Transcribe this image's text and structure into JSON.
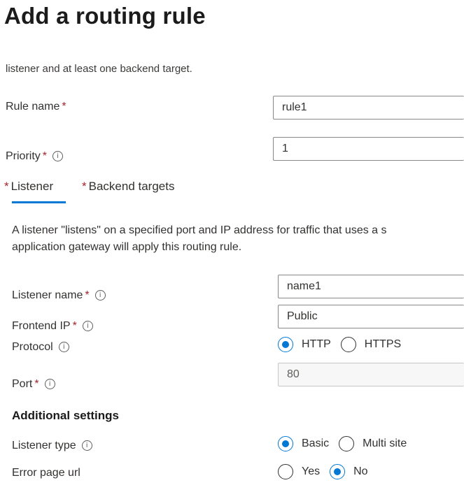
{
  "page": {
    "title": "Add a routing rule",
    "subtitle": "listener and at least one backend target."
  },
  "rule": {
    "name_label": "Rule name",
    "name_value": "rule1",
    "priority_label": "Priority",
    "priority_value": "1",
    "required_mark": "*",
    "info_glyph": "i"
  },
  "tabs": [
    {
      "label": "Listener",
      "selected": true
    },
    {
      "label": "Backend targets",
      "selected": false
    }
  ],
  "listener": {
    "description_line1": "A listener \"listens\" on a specified port and IP address for traffic that uses a s",
    "description_line2": "application gateway will apply this routing rule.",
    "name_label": "Listener name",
    "name_value": "name1",
    "frontend_ip_label": "Frontend IP",
    "frontend_ip_value": "Public",
    "protocol_label": "Protocol",
    "protocol_options": [
      "HTTP",
      "HTTPS"
    ],
    "protocol_selected": "HTTP",
    "port_label": "Port",
    "port_value": "80"
  },
  "additional_settings": {
    "heading": "Additional settings",
    "listener_type_label": "Listener type",
    "listener_type_options": [
      "Basic",
      "Multi site"
    ],
    "listener_type_selected": "Basic",
    "error_page_label": "Error page url",
    "error_page_options": [
      "Yes",
      "No"
    ],
    "error_page_selected": "No"
  },
  "colors": {
    "accent": "#0078d4",
    "required": "#a4262c",
    "text": "#323130",
    "border": "#8a8886"
  }
}
